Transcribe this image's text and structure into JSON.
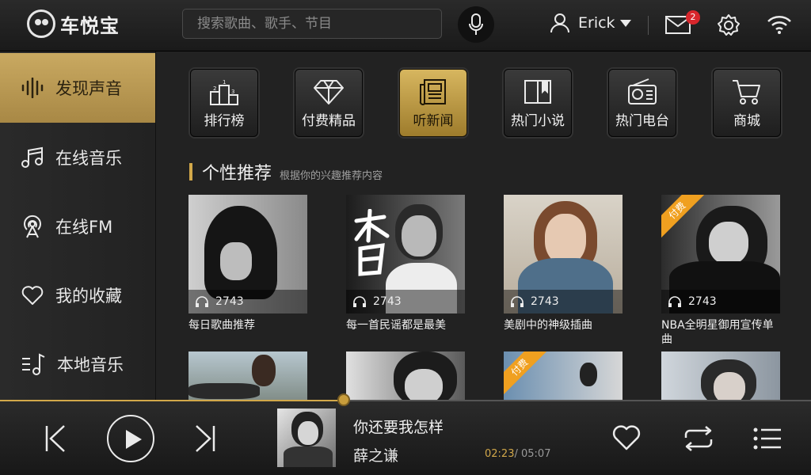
{
  "app": {
    "name": "车悦宝"
  },
  "header": {
    "search_placeholder": "搜索歌曲、歌手、节目",
    "user_name": "Erick",
    "mail_count": "2"
  },
  "sidebar": {
    "items": [
      {
        "label": "发现声音",
        "icon": "soundwave-icon",
        "active": true
      },
      {
        "label": "在线音乐",
        "icon": "music-note-icon"
      },
      {
        "label": "在线FM",
        "icon": "radio-tower-icon"
      },
      {
        "label": "我的收藏",
        "icon": "heart-icon"
      },
      {
        "label": "本地音乐",
        "icon": "local-music-icon"
      }
    ]
  },
  "categories": [
    {
      "label": "排行榜",
      "icon": "podium-icon"
    },
    {
      "label": "付费精品",
      "icon": "diamond-icon"
    },
    {
      "label": "听新闻",
      "icon": "newspaper-icon",
      "active": true
    },
    {
      "label": "热门小说",
      "icon": "book-icon"
    },
    {
      "label": "热门电台",
      "icon": "radio-icon"
    },
    {
      "label": "商城",
      "icon": "cart-icon"
    }
  ],
  "section": {
    "title": "个性推荐",
    "subtitle": "根据你的兴趣推荐内容"
  },
  "cards": [
    {
      "title": "每日歌曲推荐",
      "plays": "2743",
      "paid": false
    },
    {
      "title": "每一首民谣都是最美",
      "plays": "2743",
      "paid": false
    },
    {
      "title": "美剧中的神级插曲",
      "plays": "2743",
      "paid": false
    },
    {
      "title": "NBA全明星御用宣传单曲",
      "plays": "2743",
      "paid": true,
      "paid_label": "付费"
    }
  ],
  "cards_row2": [
    {
      "paid": false
    },
    {
      "paid": false
    },
    {
      "paid": true,
      "paid_label": "付费"
    },
    {
      "paid": false
    }
  ],
  "player": {
    "song": "你还要我怎样",
    "artist": "薛之谦",
    "current_time": "02:23",
    "separator": "/",
    "total_time": "05:07",
    "progress": 0.424
  },
  "colors": {
    "accent": "#d2a84a",
    "badge": "#d8262c",
    "paid_ribbon": "#f0a020"
  }
}
